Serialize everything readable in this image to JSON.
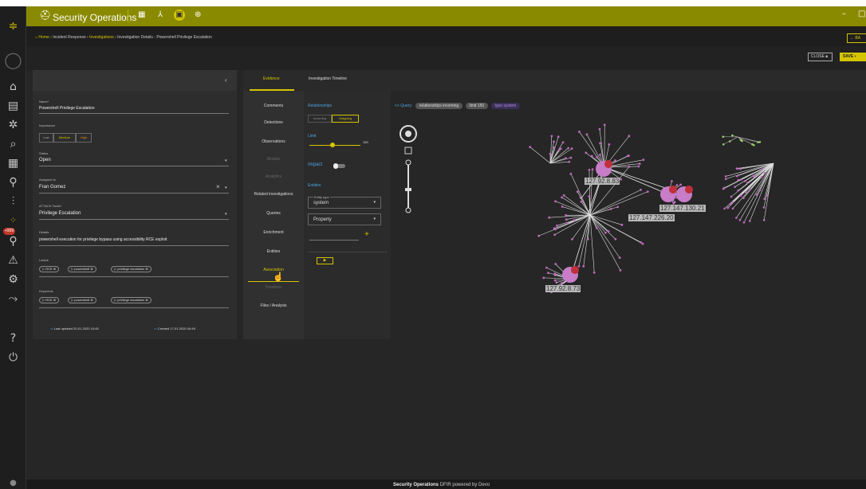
{
  "app": {
    "title": "Security Operations"
  },
  "breadcrumb": {
    "home": "Home",
    "sep1": "›",
    "incident": "Incident Response",
    "sep2": "›",
    "investigations": "Investigations",
    "sep3": "›",
    "details": "Investigation Details - Powershell Privilege Escalation"
  },
  "actions": {
    "back": "← BA",
    "close": "CLOSE",
    "save": "SAVE"
  },
  "form": {
    "name_label": "Name*",
    "name_value": "Powershell Privilege Escalation",
    "importance_label": "Importance",
    "importance_options": [
      "Low",
      "Medium",
      "High"
    ],
    "status_label": "Status",
    "status_value": "Open",
    "assigned_label": "Assigned to",
    "assigned_value": "Fran Gomez",
    "tactic_label": "ATT&CK Tactic*",
    "tactic_value": "Privilege Escalation",
    "details_label": "Details",
    "details_value": "powershell execution for privilege bypass using accessibility RCE exploit",
    "labels_label": "Labels",
    "labels": [
      "RCE",
      "powershell",
      "privilege escalation"
    ],
    "keywords_label": "Keywords",
    "keywords": [
      "RCE",
      "powershell",
      "privilege escalation"
    ],
    "last_updated": "Last updated 20-01-2020 10:45",
    "created": "Created 17-01-2020 04:49"
  },
  "tabs": {
    "evidence": "Evidence",
    "timeline": "Investigation Timeline"
  },
  "menu": [
    "Comments",
    "Detections",
    "Observations",
    "Models",
    "Analytics",
    "Related investigations",
    "Queries",
    "Enrichment",
    "Entities",
    "Association",
    "Timelines",
    "Files / Analysis"
  ],
  "controls": {
    "relationships": "Relationships",
    "incoming": "Incoming",
    "outgoing": "Outgoing",
    "limit": "Limit",
    "limit_value": "150",
    "impact": "Impact",
    "entities": "Entities",
    "entity_type_label": "Entity type",
    "entity_type_value": "system",
    "property_value": "Property",
    "plus": "+",
    "run": "▶"
  },
  "query": {
    "code_icon": "<>",
    "label": "Query:",
    "chip1_key": "relationships",
    "chip1_val": "incoming",
    "chip2_key": "limit",
    "chip2_val": "150",
    "chip3_key": "type",
    "chip3_val": "system"
  },
  "graph_nodes": [
    "127.92.8.83",
    "127.147.130.21",
    "127.147.226.20",
    "127.92.8.73"
  ],
  "footer": {
    "brand": "Security Operations",
    "powered": "DFIR powered by Devo"
  },
  "alert_count": "+999",
  "colors": {
    "accent": "#d4c500",
    "topbar": "#8a8a00",
    "link": "#4ea3e0",
    "node": "#c06ac0",
    "node_alert": "#c0303a"
  }
}
